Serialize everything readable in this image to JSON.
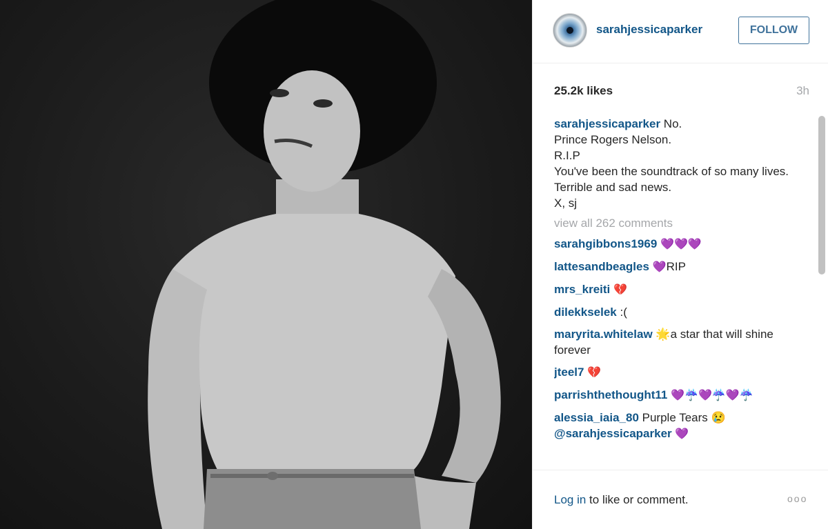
{
  "post": {
    "username": "sarahjessicaparker",
    "follow_label": "FOLLOW",
    "likes": "25.2k likes",
    "time": "3h"
  },
  "caption": {
    "username": "sarahjessicaparker",
    "lines": [
      "No.",
      "Prince Rogers Nelson.",
      "R.I.P",
      "You've been the soundtrack of so many lives.",
      "Terrible and sad news.",
      "X, sj"
    ]
  },
  "view_all": "view all 262 comments",
  "comments": [
    {
      "user": "sarahgibbons1969",
      "text": "",
      "emoji": "💜💜💜"
    },
    {
      "user": "lattesandbeagles",
      "text": "RIP",
      "emoji": "💜"
    },
    {
      "user": "mrs_kreiti",
      "text": "",
      "emoji": "💔"
    },
    {
      "user": "dilekkselek",
      "text": ":(",
      "emoji": ""
    },
    {
      "user": "maryrita.whitelaw",
      "text": "a star that will shine forever",
      "emoji": "🌟"
    },
    {
      "user": "jteel7",
      "text": "",
      "emoji": "💔"
    },
    {
      "user": "parrishthethought11",
      "text": "",
      "emoji": "💜☔💜☔💜☔"
    },
    {
      "user": "alessia_iaia_80",
      "text": "Purple Tears",
      "emoji": "😢",
      "mention": "@sarahjessicaparker",
      "mention_emoji": "💜"
    }
  ],
  "footer": {
    "login_link": "Log in",
    "login_text": " to like or comment.",
    "more": "ooo"
  },
  "icons": {
    "avatar": "eye-closeup-avatar",
    "more": "more-options-icon"
  },
  "colors": {
    "link_blue": "#125688",
    "follow_border": "#3f729b",
    "muted_gray": "#a5a7aa"
  }
}
